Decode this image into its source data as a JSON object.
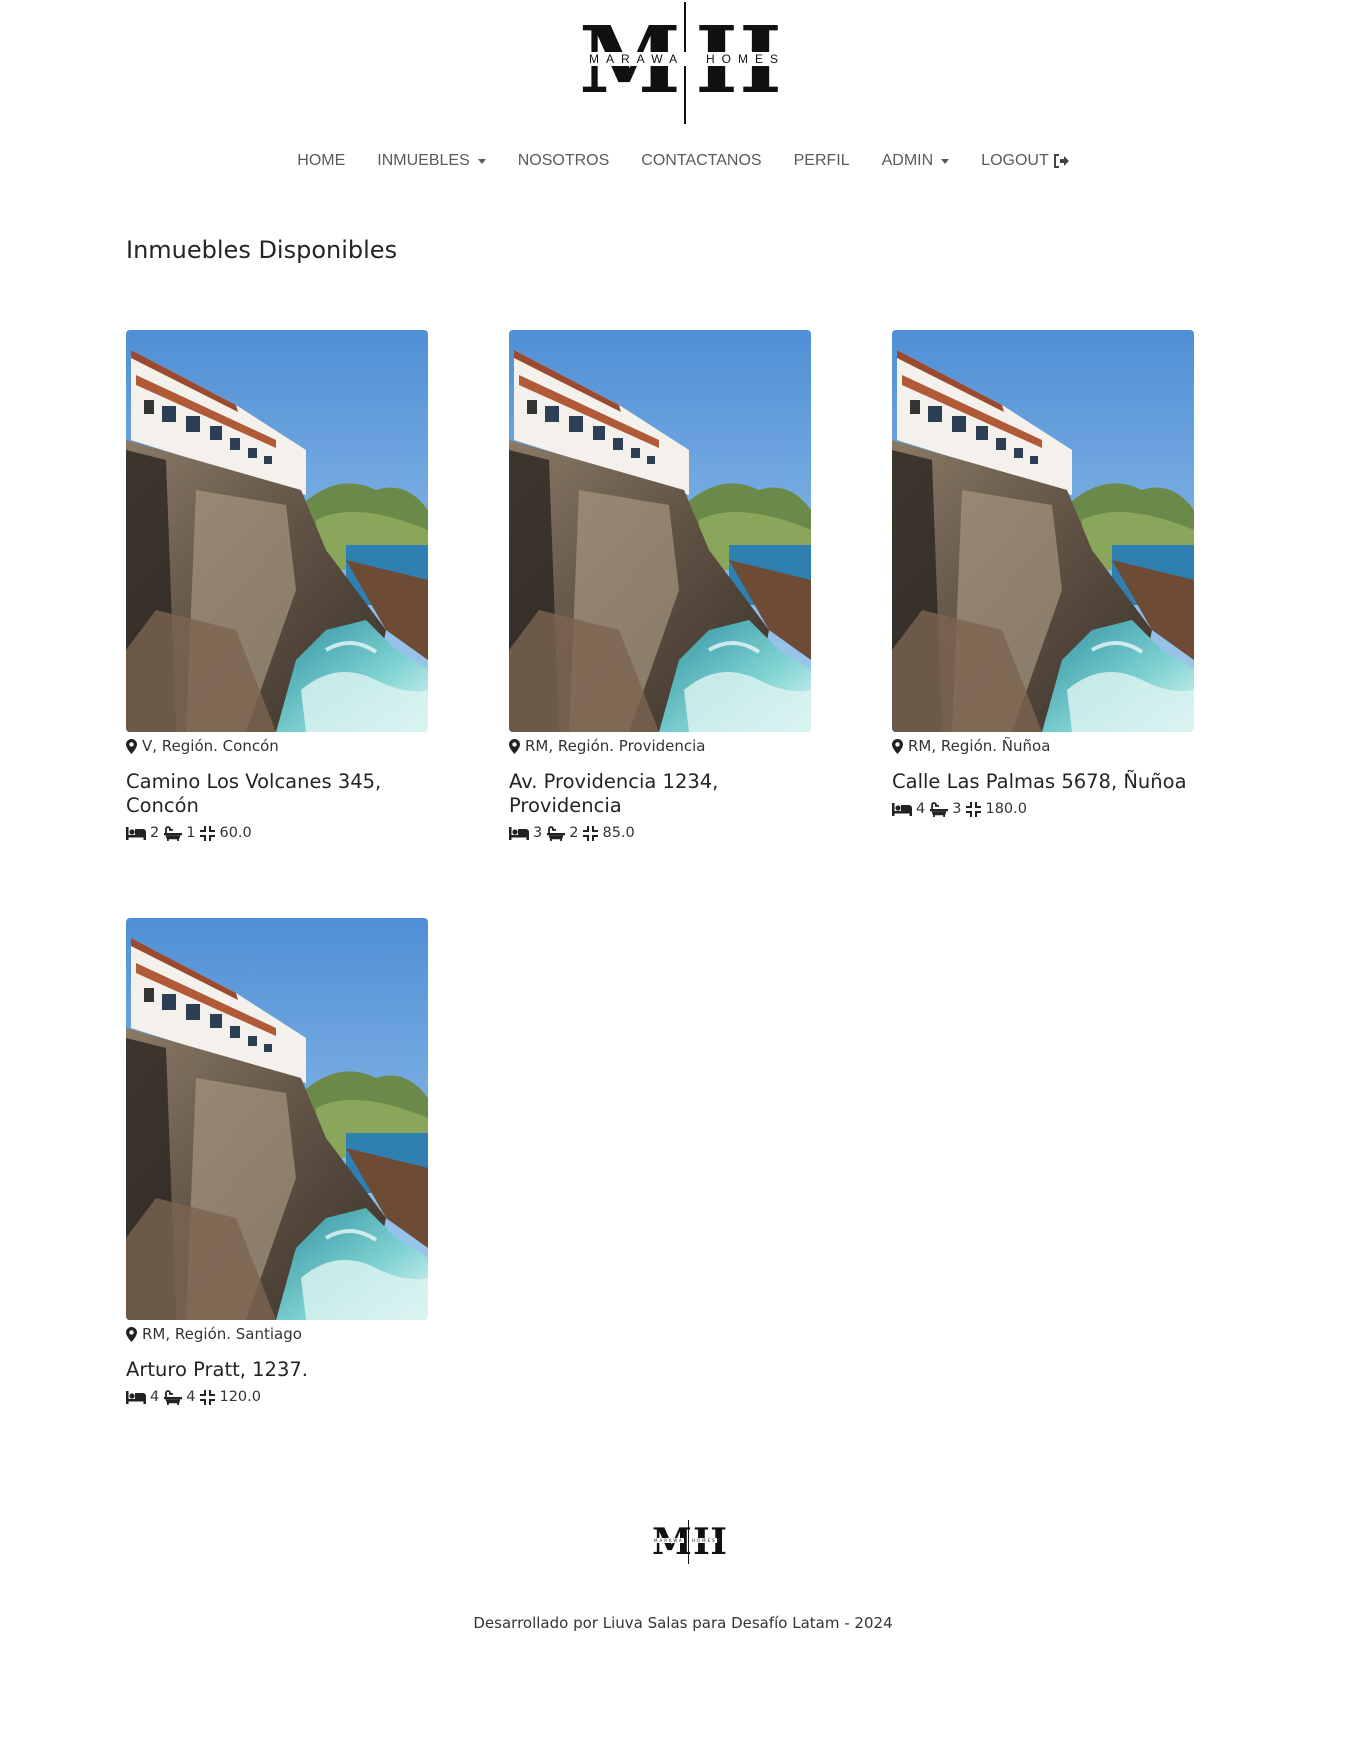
{
  "brand": {
    "logo_letters": "MH",
    "logo_left_text": "MARAWA",
    "logo_right_text": "HOMES"
  },
  "nav": {
    "items": [
      {
        "label": "HOME",
        "dropdown": false
      },
      {
        "label": "INMUEBLES",
        "dropdown": true
      },
      {
        "label": "NOSOTROS",
        "dropdown": false
      },
      {
        "label": "CONTACTANOS",
        "dropdown": false
      },
      {
        "label": "PERFIL",
        "dropdown": false
      },
      {
        "label": "ADMIN",
        "dropdown": true
      },
      {
        "label": "LOGOUT",
        "dropdown": false,
        "icon": "sign-out-icon"
      }
    ]
  },
  "main": {
    "title": "Inmuebles Disponibles",
    "properties": [
      {
        "location": "V, Región. Concón",
        "address": "Camino Los Volcanes 345, Concón",
        "bedrooms": "2",
        "bathrooms": "1",
        "area": "60.0"
      },
      {
        "location": "RM, Región. Providencia",
        "address": "Av. Providencia 1234, Providencia",
        "bedrooms": "3",
        "bathrooms": "2",
        "area": "85.0"
      },
      {
        "location": "RM, Región. Ñuñoa",
        "address": "Calle Las Palmas 5678, Ñuñoa",
        "bedrooms": "4",
        "bathrooms": "3",
        "area": "180.0"
      },
      {
        "location": "RM, Región. Santiago",
        "address": "Arturo Pratt, 1237.",
        "bedrooms": "4",
        "bathrooms": "4",
        "area": "120.0"
      }
    ]
  },
  "footer": {
    "credits": "Desarrollado por Liuva Salas para Desafío Latam - 2024"
  },
  "icons": {
    "location": "map-marker-icon",
    "bed": "bed-icon",
    "bath": "bath-icon",
    "area": "compress-icon"
  }
}
